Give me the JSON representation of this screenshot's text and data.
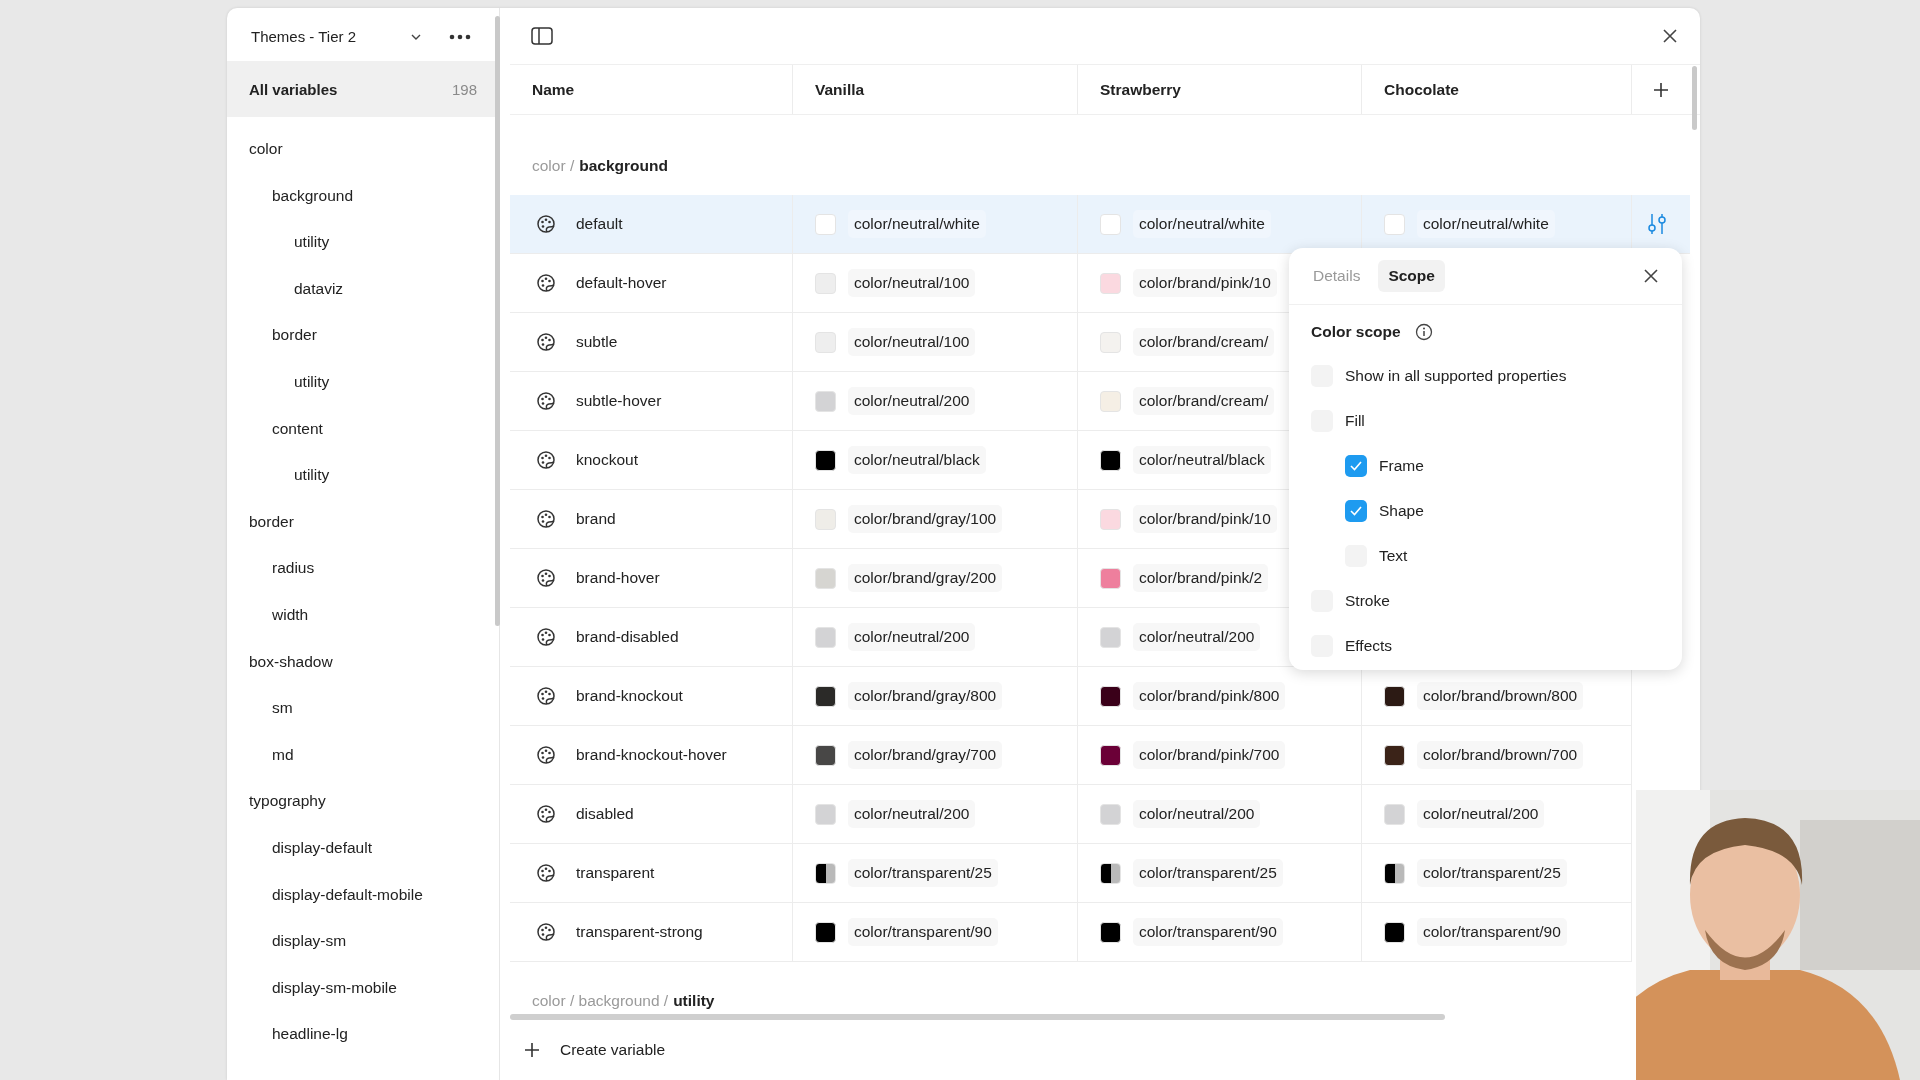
{
  "sidebar": {
    "collection": "Themes - Tier 2",
    "all_variables": {
      "label": "All variables",
      "count": "198",
      "selected": true
    },
    "tree": [
      {
        "label": "color",
        "selected": false,
        "children": [
          {
            "label": "background",
            "selected": false,
            "children": [
              {
                "label": "utility",
                "selected": false
              },
              {
                "label": "dataviz",
                "selected": false
              }
            ]
          },
          {
            "label": "border",
            "selected": false,
            "children": [
              {
                "label": "utility",
                "selected": false
              }
            ]
          },
          {
            "label": "content",
            "selected": false,
            "children": [
              {
                "label": "utility",
                "selected": false
              }
            ]
          }
        ]
      },
      {
        "label": "border",
        "selected": false,
        "children": [
          {
            "label": "radius",
            "selected": false
          },
          {
            "label": "width",
            "selected": false
          }
        ]
      },
      {
        "label": "box-shadow",
        "selected": false,
        "children": [
          {
            "label": "sm",
            "selected": false
          },
          {
            "label": "md",
            "selected": false
          }
        ]
      },
      {
        "label": "typography",
        "selected": false,
        "children": [
          {
            "label": "display-default",
            "selected": false
          },
          {
            "label": "display-default-mobile",
            "selected": false
          },
          {
            "label": "display-sm",
            "selected": false
          },
          {
            "label": "display-sm-mobile",
            "selected": false
          },
          {
            "label": "headline-lg",
            "selected": false
          }
        ]
      }
    ]
  },
  "table": {
    "columns": [
      "Name",
      "Vanilla",
      "Strawberry",
      "Chocolate"
    ],
    "group": {
      "path": "color /",
      "name": "background"
    },
    "rows": [
      {
        "name": "default",
        "selected": true,
        "values": [
          {
            "kind": "solid",
            "color": "#ffffff",
            "text": "color/neutral/white"
          },
          {
            "kind": "solid",
            "color": "#ffffff",
            "text": "color/neutral/white"
          },
          {
            "kind": "solid",
            "color": "#ffffff",
            "text": "color/neutral/white"
          }
        ]
      },
      {
        "name": "default-hover",
        "selected": false,
        "values": [
          {
            "kind": "solid",
            "color": "#eeeeee",
            "text": "color/neutral/100"
          },
          {
            "kind": "solid",
            "color": "#fbd9e0",
            "text": "color/brand/pink/10"
          }
        ]
      },
      {
        "name": "subtle",
        "selected": false,
        "values": [
          {
            "kind": "solid",
            "color": "#eeeeee",
            "text": "color/neutral/100"
          },
          {
            "kind": "solid",
            "color": "#f4f2ef",
            "text": "color/brand/cream/"
          }
        ]
      },
      {
        "name": "subtle-hover",
        "selected": false,
        "values": [
          {
            "kind": "solid",
            "color": "#d3d3d5",
            "text": "color/neutral/200"
          },
          {
            "kind": "solid",
            "color": "#f5efe5",
            "text": "color/brand/cream/"
          }
        ]
      },
      {
        "name": "knockout",
        "selected": false,
        "values": [
          {
            "kind": "solid",
            "color": "#000000",
            "text": "color/neutral/black"
          },
          {
            "kind": "solid",
            "color": "#000000",
            "text": "color/neutral/black"
          }
        ]
      },
      {
        "name": "brand",
        "selected": false,
        "values": [
          {
            "kind": "solid",
            "color": "#efede8",
            "text": "color/brand/gray/100"
          },
          {
            "kind": "solid",
            "color": "#fbd9e0",
            "text": "color/brand/pink/10"
          }
        ]
      },
      {
        "name": "brand-hover",
        "selected": false,
        "values": [
          {
            "kind": "solid",
            "color": "#d6d5d1",
            "text": "color/brand/gray/200"
          },
          {
            "kind": "solid",
            "color": "#ee7f9d",
            "text": "color/brand/pink/2"
          }
        ]
      },
      {
        "name": "brand-disabled",
        "selected": false,
        "values": [
          {
            "kind": "solid",
            "color": "#d3d3d5",
            "text": "color/neutral/200"
          },
          {
            "kind": "solid",
            "color": "#d3d3d5",
            "text": "color/neutral/200"
          }
        ]
      },
      {
        "name": "brand-knockout",
        "selected": false,
        "values": [
          {
            "kind": "solid",
            "color": "#2b2a28",
            "text": "color/brand/gray/800"
          },
          {
            "kind": "solid",
            "color": "#3a0019",
            "text": "color/brand/pink/800"
          },
          {
            "kind": "solid",
            "color": "#2c1a14",
            "text": "color/brand/brown/800"
          }
        ]
      },
      {
        "name": "brand-knockout-hover",
        "selected": false,
        "values": [
          {
            "kind": "solid",
            "color": "#484746",
            "text": "color/brand/gray/700"
          },
          {
            "kind": "solid",
            "color": "#6b0037",
            "text": "color/brand/pink/700"
          },
          {
            "kind": "solid",
            "color": "#3b2318",
            "text": "color/brand/brown/700"
          }
        ]
      },
      {
        "name": "disabled",
        "selected": false,
        "values": [
          {
            "kind": "solid",
            "color": "#d3d3d5",
            "text": "color/neutral/200"
          },
          {
            "kind": "solid",
            "color": "#d3d3d5",
            "text": "color/neutral/200"
          },
          {
            "kind": "solid",
            "color": "#d3d3d5",
            "text": "color/neutral/200"
          }
        ]
      },
      {
        "name": "transparent",
        "selected": false,
        "values": [
          {
            "kind": "split",
            "color": "#000000",
            "text": "color/transparent/25"
          },
          {
            "kind": "split",
            "color": "#000000",
            "text": "color/transparent/25"
          },
          {
            "kind": "split",
            "color": "#000000",
            "text": "color/transparent/25"
          }
        ]
      },
      {
        "name": "transparent-strong",
        "selected": false,
        "values": [
          {
            "kind": "solid",
            "color": "#000000",
            "text": "color/transparent/90"
          },
          {
            "kind": "solid",
            "color": "#000000",
            "text": "color/transparent/90"
          },
          {
            "kind": "solid",
            "color": "#000000",
            "text": "color/transparent/90"
          }
        ]
      }
    ],
    "next_group": {
      "path": "color / background /",
      "name": "utility"
    },
    "create": "Create variable"
  },
  "popover": {
    "tabs": [
      {
        "label": "Details",
        "selected": false
      },
      {
        "label": "Scope",
        "selected": true
      }
    ],
    "heading": "Color scope",
    "options": [
      {
        "label": "Show in all supported properties",
        "checked": false
      },
      {
        "label": "Fill",
        "checked": false,
        "children": [
          {
            "label": "Frame",
            "checked": true
          },
          {
            "label": "Shape",
            "checked": true
          },
          {
            "label": "Text",
            "checked": false
          }
        ]
      },
      {
        "label": "Stroke",
        "checked": false
      },
      {
        "label": "Effects",
        "checked": false
      }
    ]
  }
}
